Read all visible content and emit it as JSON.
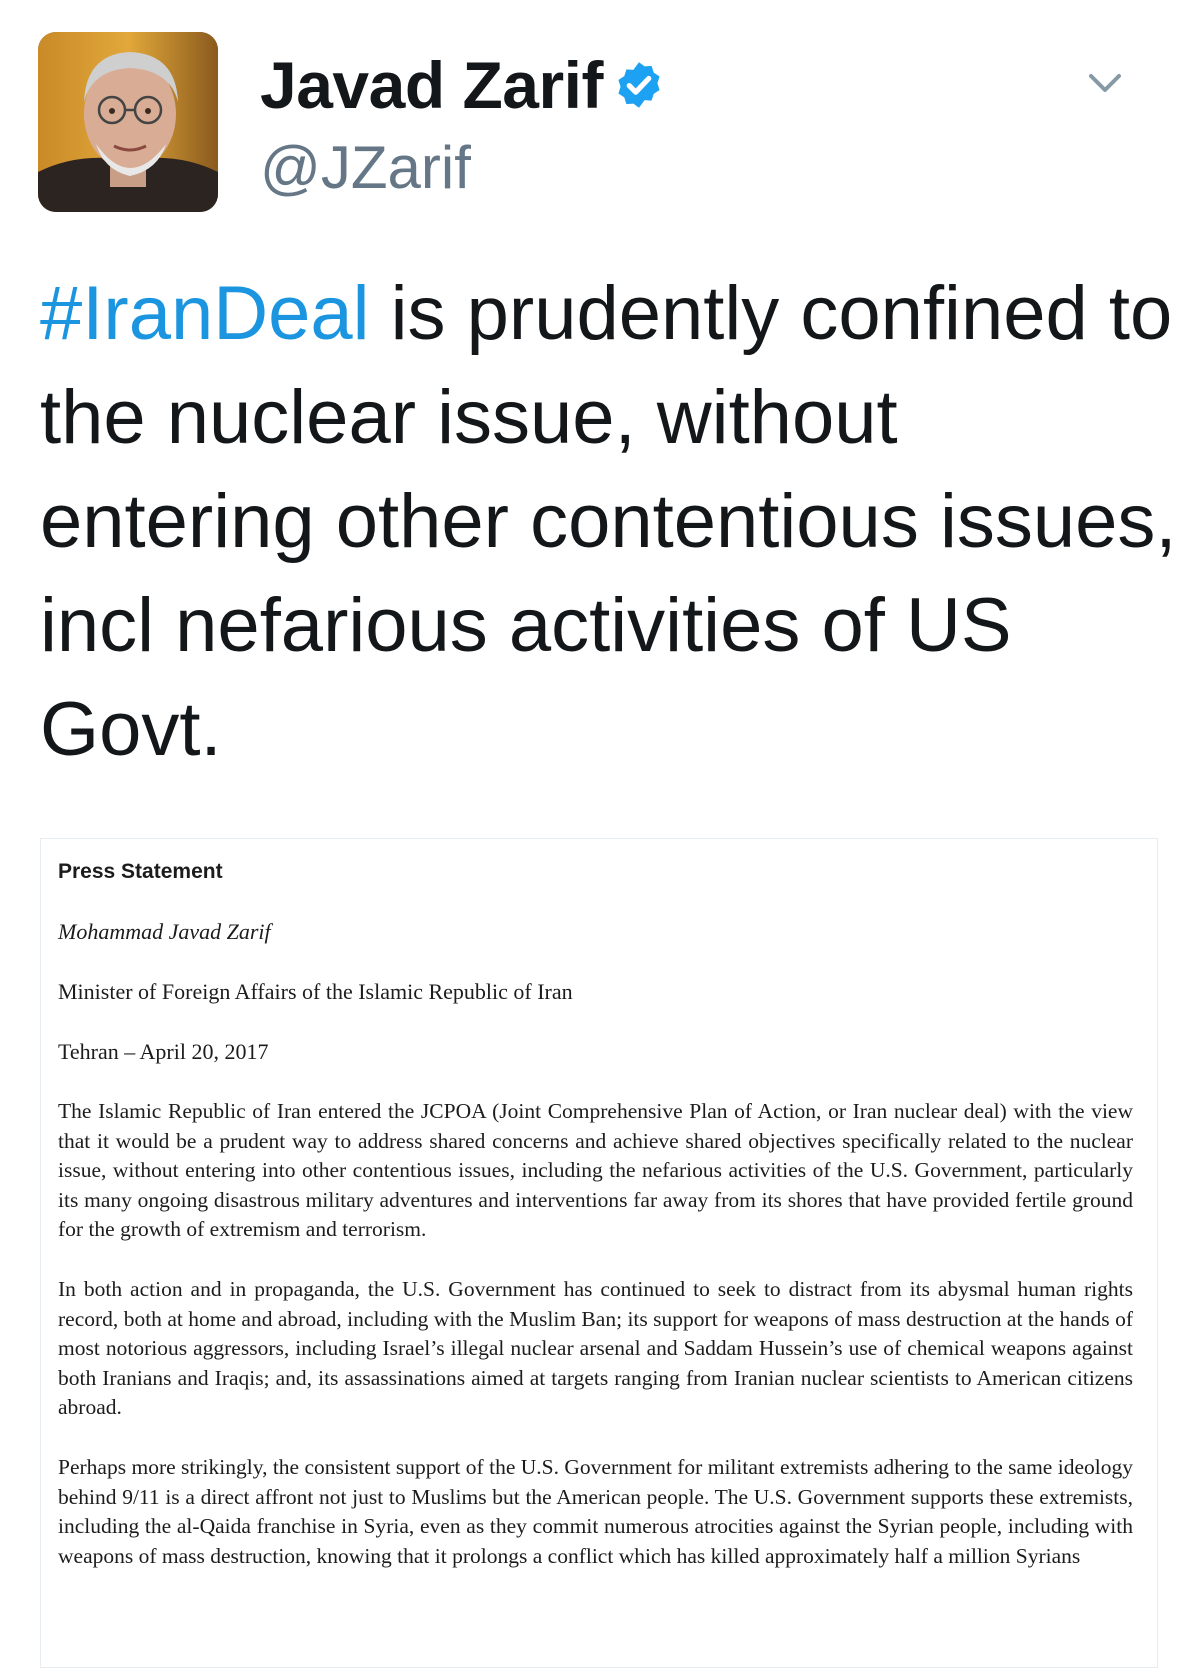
{
  "tweet": {
    "display_name": "Javad Zarif",
    "handle": "@JZarif",
    "hashtag": "#IranDeal",
    "text_rest": " is prudently confined to the nuclear issue, without entering other contentious issues, incl nefarious activities of US Govt."
  },
  "icons": {
    "verified": "verified-badge-icon",
    "menu": "chevron-down-icon"
  },
  "colors": {
    "hashtag": "#1b95e0",
    "verified": "#1da1f2",
    "handle": "#657786"
  },
  "statement": {
    "title": "Press Statement",
    "author": "Mohammad Javad Zarif",
    "position": "Minister of Foreign Affairs of the Islamic Republic of Iran",
    "dateline": "Tehran – April 20, 2017",
    "paragraphs": [
      "The Islamic Republic of Iran entered the JCPOA (Joint Comprehensive Plan of Action, or Iran nuclear deal) with the view that it would be a prudent way to address shared concerns and achieve shared objectives specifically related to the nuclear issue, without entering into other contentious issues, including the nefarious activities of the U.S. Government, particularly its many ongoing disastrous military adventures and interventions far away from its shores that have provided fertile ground for the growth of extremism and terrorism.",
      "In both action and in propaganda, the U.S. Government has continued to seek to distract from its abysmal human rights record, both at home and abroad, including with the Muslim Ban; its support for weapons of mass destruction at the hands of most notorious aggressors, including Israel’s illegal nuclear arsenal and Saddam Hussein’s use of chemical weapons against both Iranians and Iraqis; and, its assassinations aimed at targets ranging from Iranian nuclear scientists to American citizens abroad.",
      "Perhaps more strikingly, the consistent support of the U.S. Government for militant extremists adhering to the same ideology behind 9/11 is a direct affront not just to Muslims but the American people. The U.S. Government supports these extremists, including the al-Qaida franchise in Syria, even as they commit numerous atrocities against the Syrian people, including with weapons of mass destruction, knowing that it prolongs a conflict which has killed approximately half a million Syrians"
    ]
  }
}
